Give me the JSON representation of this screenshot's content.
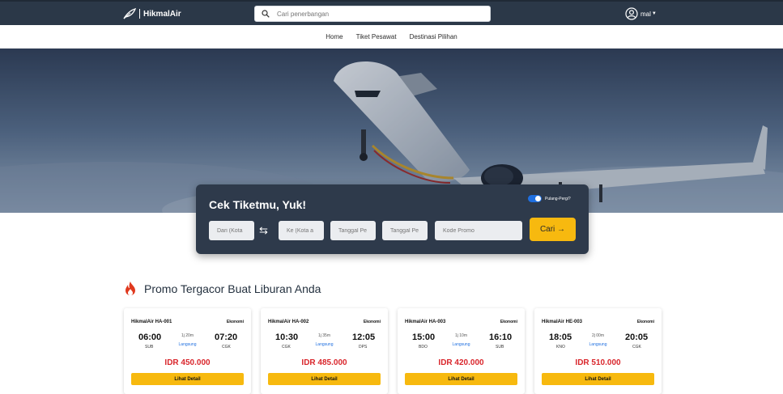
{
  "header": {
    "brand": "HikmalAir",
    "search_placeholder": "Cari penerbangan",
    "user_name": "mal"
  },
  "nav": {
    "items": [
      "Home",
      "Tiket Pesawat",
      "Destinasi Pilihan"
    ]
  },
  "search_card": {
    "title": "Cek Tiketmu, Yuk!",
    "toggle_label": "Pulang-Pergi?",
    "toggle_on": true,
    "from_placeholder": "Dari (Kota",
    "to_placeholder": "Ke (Kota a",
    "depart_placeholder": "Tanggal Pe",
    "return_placeholder": "Tanggal Pe",
    "promo_placeholder": "Kode Promo",
    "search_button": "Cari →"
  },
  "promo": {
    "title": "Promo Tergacor Buat Liburan Anda",
    "cards": [
      {
        "flight": "HikmalAir HA-001",
        "class": "Ekonomi",
        "depart_time": "06:00",
        "depart_code": "SUB",
        "duration": "1j 20m",
        "type": "Langsung",
        "arrive_time": "07:20",
        "arrive_code": "CGK",
        "price": "IDR 450.000",
        "button": "Lihat Detail"
      },
      {
        "flight": "HikmalAir HA-002",
        "class": "Ekonomi",
        "depart_time": "10:30",
        "depart_code": "CGK",
        "duration": "1j 35m",
        "type": "Langsung",
        "arrive_time": "12:05",
        "arrive_code": "DPS",
        "price": "IDR 485.000",
        "button": "Lihat Detail"
      },
      {
        "flight": "HikmalAir HA-003",
        "class": "Ekonomi",
        "depart_time": "15:00",
        "depart_code": "BDO",
        "duration": "1j 10m",
        "type": "Langsung",
        "arrive_time": "16:10",
        "arrive_code": "SUB",
        "price": "IDR 420.000",
        "button": "Lihat Detail"
      },
      {
        "flight": "HikmalAir HE-003",
        "class": "Ekonomi",
        "depart_time": "18:05",
        "depart_code": "KNO",
        "duration": "2j 00m",
        "type": "Langsung",
        "arrive_time": "20:05",
        "arrive_code": "CGK",
        "price": "IDR 510.000",
        "button": "Lihat Detail"
      }
    ]
  },
  "colors": {
    "navbar": "#2b3848",
    "accent_yellow": "#f7b90f",
    "price_red": "#d9262c",
    "card_dark": "#2e3a4b",
    "link_blue": "#1f6fe0"
  },
  "icons": {
    "logo": "feather-icon",
    "search": "search-icon",
    "user": "user-circle-icon",
    "swap": "swap-arrows-icon",
    "promo": "fire-icon"
  }
}
